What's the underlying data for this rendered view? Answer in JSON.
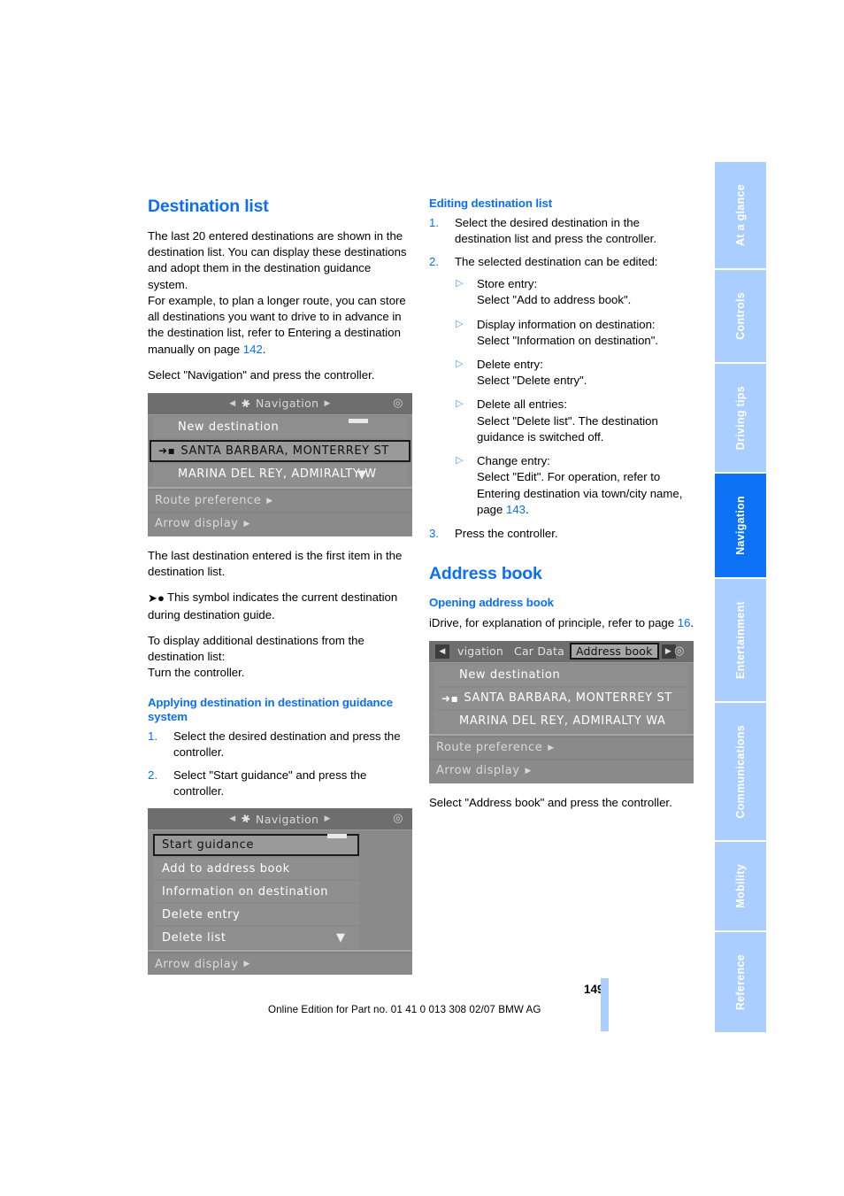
{
  "document": {
    "page_number": "149",
    "footer": "Online Edition for Part no. 01 41 0 013 308 02/07 BMW AG"
  },
  "sidebar": {
    "tabs": [
      {
        "label": "At a glance",
        "active": false
      },
      {
        "label": "Controls",
        "active": false
      },
      {
        "label": "Driving tips",
        "active": false
      },
      {
        "label": "Navigation",
        "active": true
      },
      {
        "label": "Entertainment",
        "active": false
      },
      {
        "label": "Communications",
        "active": false
      },
      {
        "label": "Mobility",
        "active": false
      },
      {
        "label": "Reference",
        "active": false
      }
    ],
    "colors": {
      "inactive": "#aaceff",
      "active": "#0d72f5",
      "label": "#ffffff"
    }
  },
  "colors": {
    "heading_blue": "#0b6ef5",
    "link_blue": "#0b6ef5",
    "screen_gray": "#8a8a8a"
  },
  "left_column": {
    "heading": "Destination list",
    "para_1": "The last 20 entered destinations are shown in the destination list. You can display these destinations and adopt them in the destination guidance system.",
    "para_2_pre": "For example, to plan a longer route, you can store all destinations you want to drive to in advance in the destination list, refer to Entering a destination manually on page ",
    "para_2_link": "142",
    "para_2_post": ".",
    "para_3": "Select \"Navigation\" and press the controller.",
    "para_4": "The last destination entered is the first item in the destination list.",
    "symbol_note": "This symbol indicates the current destination during destination guide.",
    "para_5": "To display additional destinations from the destination list:",
    "para_6": "Turn the controller.",
    "subheading": "Applying destination in destination guidance system",
    "steps": [
      {
        "num": "1.",
        "text": "Select the desired destination and press the controller."
      },
      {
        "num": "2.",
        "text": "Select \"Start guidance\" and press the controller."
      }
    ]
  },
  "right_column": {
    "subheading_1": "Editing destination list",
    "steps": [
      {
        "num": "1.",
        "text": "Select the desired destination in the destination list and press the controller."
      },
      {
        "num": "2.",
        "text": "The selected destination can be edited:"
      }
    ],
    "options": [
      {
        "title": "Store entry:",
        "detail": "Select \"Add to address book\"."
      },
      {
        "title": "Display information on destination:",
        "detail": "Select \"Information on destination\"."
      },
      {
        "title": "Delete entry:",
        "detail": "Select \"Delete entry\"."
      },
      {
        "title": "Delete all entries:",
        "detail": "Select \"Delete list\". The destination guidance is switched off."
      },
      {
        "title": "Change entry:",
        "detail_pre": "Select \"Edit\". For operation, refer to Entering destination via town/city name, page ",
        "detail_link": "143",
        "detail_post": "."
      }
    ],
    "step_3": {
      "num": "3.",
      "text": "Press the controller."
    },
    "heading_2": "Address book",
    "subheading_2": "Opening address book",
    "para_1_pre": "iDrive, for explanation of principle, refer to page ",
    "para_1_link": "16",
    "para_1_post": ".",
    "para_2": "Select \"Address book\" and press the controller."
  },
  "screens": {
    "nav_destination_list": {
      "title": "Navigation",
      "items": [
        {
          "label": "New destination",
          "selected": false,
          "marker": ""
        },
        {
          "label": "SANTA BARBARA, MONTERREY ST",
          "selected": true,
          "marker": "➜▪"
        },
        {
          "label": "MARINA DEL REY, ADMIRALTY W",
          "selected": false,
          "marker": ""
        }
      ],
      "footer_items": [
        "Route preference",
        "Arrow display"
      ]
    },
    "nav_edit_menu": {
      "title": "Navigation",
      "items": [
        {
          "label": "Start guidance",
          "selected": true
        },
        {
          "label": "Add to address book",
          "selected": false
        },
        {
          "label": "Information on destination",
          "selected": false
        },
        {
          "label": "Delete entry",
          "selected": false
        },
        {
          "label": "Delete list",
          "selected": false
        }
      ],
      "footer_items": [
        "Arrow display"
      ]
    },
    "address_book_tabs": {
      "tabs": [
        {
          "label": "vigation",
          "current": false
        },
        {
          "label": "Car Data",
          "current": false
        },
        {
          "label": "Address book",
          "current": true
        }
      ],
      "items": [
        {
          "label": "New destination",
          "marker": ""
        },
        {
          "label": "SANTA BARBARA, MONTERREY ST",
          "marker": "➜▪"
        },
        {
          "label": "MARINA DEL REY, ADMIRALTY WA",
          "marker": ""
        }
      ],
      "footer_items": [
        "Route preference",
        "Arrow display"
      ]
    }
  }
}
